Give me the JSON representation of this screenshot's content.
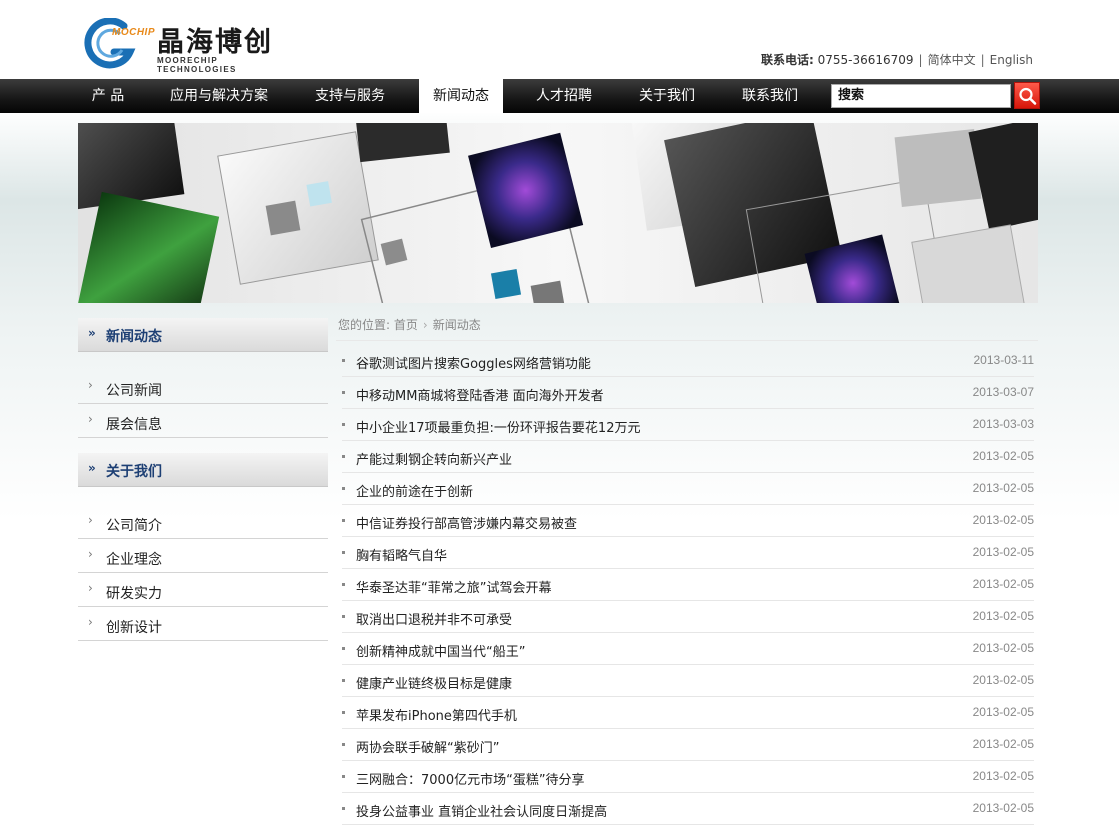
{
  "brand": {
    "logo_mark": "MOCHIP",
    "name_cn": "晶海博创",
    "name_en": "MOORECHIP TECHNOLOGIES",
    "accent_orange": "#e8891a",
    "accent_blue": "#1a6fb5"
  },
  "header": {
    "contact_label": "联系电话:",
    "phone": "0755-36616709",
    "lang_cn": "简体中文",
    "lang_en": "English"
  },
  "nav": {
    "items": [
      {
        "label": "产 品"
      },
      {
        "label": "应用与解决方案"
      },
      {
        "label": "支持与服务"
      },
      {
        "label": "新闻动态",
        "active": true
      },
      {
        "label": "人才招聘"
      },
      {
        "label": "关于我们"
      },
      {
        "label": "联系我们"
      }
    ],
    "search_placeholder": "搜索",
    "search_icon": "magnifier-icon"
  },
  "sidebar": {
    "sections": [
      {
        "title": "新闻动态",
        "items": [
          "公司新闻",
          "展会信息"
        ]
      },
      {
        "title": "关于我们",
        "items": [
          "公司简介",
          "企业理念",
          "研发实力",
          "创新设计"
        ]
      }
    ]
  },
  "breadcrumb": {
    "prefix": "您的位置:",
    "home": "首页",
    "current": "新闻动态"
  },
  "news": [
    {
      "title": "谷歌测试图片搜索Goggles网络营销功能",
      "date": "2013-03-11"
    },
    {
      "title": "中移动MM商城将登陆香港 面向海外开发者",
      "date": "2013-03-07"
    },
    {
      "title": "中小企业17项最重负担:一份环评报告要花12万元",
      "date": "2013-03-03"
    },
    {
      "title": "产能过剩钢企转向新兴产业",
      "date": "2013-02-05"
    },
    {
      "title": "企业的前途在于创新",
      "date": "2013-02-05"
    },
    {
      "title": "中信证券投行部高管涉嫌内幕交易被查",
      "date": "2013-02-05"
    },
    {
      "title": "胸有韬略气自华",
      "date": "2013-02-05"
    },
    {
      "title": "华泰圣达菲“菲常之旅”试驾会开幕",
      "date": "2013-02-05"
    },
    {
      "title": "取消出口退税并非不可承受",
      "date": "2013-02-05"
    },
    {
      "title": "创新精神成就中国当代“船王”",
      "date": "2013-02-05"
    },
    {
      "title": "健康产业链终极目标是健康",
      "date": "2013-02-05"
    },
    {
      "title": "苹果发布iPhone第四代手机",
      "date": "2013-02-05"
    },
    {
      "title": "两协会联手破解“紫砂门”",
      "date": "2013-02-05"
    },
    {
      "title": "三网融合：7000亿元市场“蛋糕”待分享",
      "date": "2013-02-05"
    },
    {
      "title": "投身公益事业 直销企业社会认同度日渐提高",
      "date": "2013-02-05"
    }
  ]
}
